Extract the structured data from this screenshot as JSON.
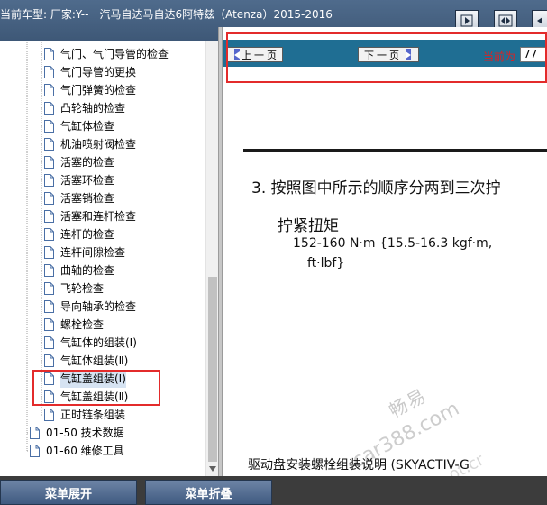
{
  "header": {
    "title": "当前车型:  厂家:Y--一汽马自达马自达6阿特兹（Atenza）2015-2016",
    "buttons": [
      {
        "icon": "collapse-left-icon"
      },
      {
        "icon": "expand-horizontal-icon"
      },
      {
        "icon": "collapse-right-icon"
      }
    ]
  },
  "tree": {
    "items": [
      {
        "label": "气门、气门导管的检查",
        "level": 2
      },
      {
        "label": "气门导管的更换",
        "level": 2
      },
      {
        "label": "气门弹簧的检查",
        "level": 2
      },
      {
        "label": "凸轮轴的检查",
        "level": 2
      },
      {
        "label": "气缸体检查",
        "level": 2
      },
      {
        "label": "机油喷射阀检查",
        "level": 2
      },
      {
        "label": "活塞的检查",
        "level": 2
      },
      {
        "label": "活塞环检查",
        "level": 2
      },
      {
        "label": "活塞销检查",
        "level": 2
      },
      {
        "label": "活塞和连杆检查",
        "level": 2
      },
      {
        "label": "连杆的检查",
        "level": 2
      },
      {
        "label": "连杆间隙检查",
        "level": 2
      },
      {
        "label": "曲轴的检查",
        "level": 2
      },
      {
        "label": "飞轮检查",
        "level": 2
      },
      {
        "label": "导向轴承的检查",
        "level": 2
      },
      {
        "label": "螺栓检查",
        "level": 2
      },
      {
        "label": "气缸体的组装(Ⅰ)",
        "level": 2
      },
      {
        "label": "气缸体组装(Ⅱ)",
        "level": 2
      },
      {
        "label": "气缸盖组装(Ⅰ)",
        "level": 2,
        "selected": true
      },
      {
        "label": "气缸盖组装(Ⅱ)",
        "level": 2
      },
      {
        "label": "正时链条组装",
        "level": 2
      },
      {
        "label": "01-50 技术数据",
        "level": 1
      },
      {
        "label": "01-60 维修工具",
        "level": 1
      }
    ]
  },
  "navbar": {
    "prev_label": "上一页",
    "next_label": "下一页",
    "current_label": "当前为",
    "page_value": "77"
  },
  "document": {
    "step": "3.  按照图中所示的顺序分两到三次拧",
    "torque_title": "拧紧扭矩",
    "torque_line1": "152-160 N·m {15.5-16.3 kgf·m,",
    "torque_line2": "ft·lbf}",
    "caption": "驱动盘安装螺栓组装说明 (SKYACTIV-G",
    "watermark_line1": "畅易",
    "watermark_line2": "car388.com",
    "watermark_line3": "ot.cr"
  },
  "bottom": {
    "expand_label": "菜单展开",
    "collapse_label": "菜单折叠"
  },
  "colors": {
    "header_bg": "#46617f",
    "navbar_bg": "#1f6e93",
    "highlight_red": "#e32b2b",
    "current_page_red": "#e02020",
    "bottom_bg": "#3c3c3c",
    "bottom_button": "#4f6a90"
  }
}
